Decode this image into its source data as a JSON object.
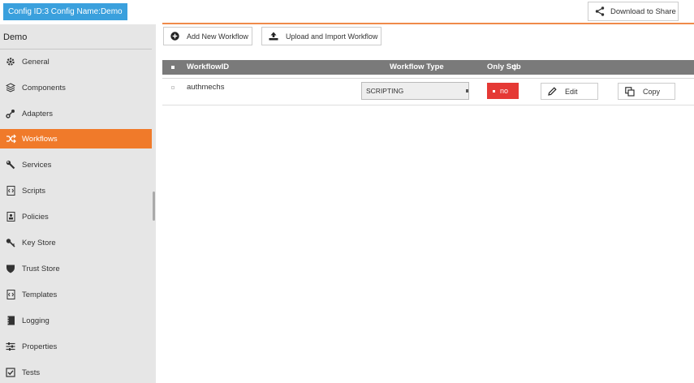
{
  "topbar": {
    "config_label": "Config ID:3 Config Name:Demo",
    "download_label": "Download to Share"
  },
  "sidebar": {
    "title": "Demo",
    "items": [
      {
        "label": "General",
        "icon": "gear-icon"
      },
      {
        "label": "Components",
        "icon": "layers-icon"
      },
      {
        "label": "Adapters",
        "icon": "adapter-icon"
      },
      {
        "label": "Workflows",
        "icon": "shuffle-icon",
        "active": true
      },
      {
        "label": "Services",
        "icon": "wrench-icon"
      },
      {
        "label": "Scripts",
        "icon": "script-icon"
      },
      {
        "label": "Policies",
        "icon": "policy-icon"
      },
      {
        "label": "Key Store",
        "icon": "key-icon"
      },
      {
        "label": "Trust Store",
        "icon": "shield-icon"
      },
      {
        "label": "Templates",
        "icon": "code-file-icon"
      },
      {
        "label": "Logging",
        "icon": "notebook-icon"
      },
      {
        "label": "Properties",
        "icon": "sliders-icon"
      },
      {
        "label": "Tests",
        "icon": "checkbox-icon"
      }
    ]
  },
  "toolbar": {
    "add_label": "Add New Workflow",
    "upload_label": "Upload and Import Workflow"
  },
  "grid": {
    "columns": {
      "id": "WorkflowID",
      "type": "Workflow Type",
      "only_sub": "Only Sub"
    },
    "rows": [
      {
        "id": "authmechs",
        "type": "SCRIPTING",
        "only_sub": "no",
        "edit_label": "Edit",
        "copy_label": "Copy"
      }
    ]
  },
  "colors": {
    "accent": "#f07a2a",
    "badge": "#3aa0dd",
    "no_button": "#e53935",
    "grid_header": "#7a7a7a"
  }
}
